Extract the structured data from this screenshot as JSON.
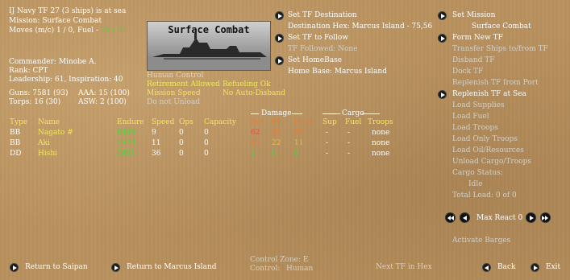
{
  "header": {
    "line1": "IJ Navy TF 27 (3 ships) is at sea",
    "mission": "Mission:  Surface Combat",
    "moves": "Moves (m/c)  1 / 0, Fuel - ",
    "fuel": "76 / 21"
  },
  "commander": {
    "name": "Commander: Minobe A.",
    "rank": "Rank: CPT",
    "leadership": "Leadership: 61, Inspiration: 40"
  },
  "stats": {
    "guns": "Guns: 7581 (93)",
    "aaa": "AAA: 15 (100)",
    "torps": "Torps: 16 (30)",
    "asw": "ASW: 2 (100)"
  },
  "photo_title": "Surface Combat",
  "control": {
    "human": "Human Control",
    "retirement": "Retirement Allowed",
    "mission_speed": "Mission Speed",
    "no_unload": "Do not Unload",
    "refueling": "Refueling Ok",
    "auto_disband": "No Auto-Disband"
  },
  "mid_menu": {
    "set_dest": "Set TF Destination",
    "dest_hex": "Destination Hex: Marcus Island - 75,56",
    "set_follow": "Set TF to Follow",
    "followed": "TF Followed: None",
    "set_home": "Set HomeBase",
    "home": "Home Base: Marcus Island"
  },
  "right_menu": {
    "set_mission": "Set Mission",
    "mission_val": "Surface Combat",
    "form_new": "Form New TF",
    "transfer": "Transfer Ships to/from TF",
    "disband": "Disband TF",
    "dock": "Dock TF",
    "replenish_port": "Replenish TF from Port",
    "replenish_sea": "Replenish TF at Sea",
    "load_supplies": "Load Supplies",
    "load_fuel": "Load Fuel",
    "load_troops": "Load Troops",
    "load_only_troops": "Load Only Troops",
    "load_oil": "Load Oil/Resources",
    "unload": "Unload Cargo/Troops",
    "cargo_status": "Cargo Status:",
    "idle": "Idle",
    "total_load": "Total Load: 0 of 0",
    "max_react": "Max React 0",
    "activate_barges": "Activate Barges"
  },
  "table": {
    "group_damage": "Damage",
    "group_cargo": "Cargo",
    "headers": [
      "Type",
      "Name",
      "Endure",
      "Speed",
      "Ops",
      "Capacity",
      "Sys",
      "Flt",
      "Fires",
      "Sup",
      "Fuel",
      "Troops"
    ],
    "rows": [
      [
        "BB",
        "Nagato #",
        "6499",
        "9",
        "0",
        "0",
        "62",
        "29",
        "27",
        "-",
        "-",
        "none"
      ],
      [
        "BB",
        "Aki",
        "3809",
        "11",
        "0",
        "0",
        "43",
        "22",
        "11",
        "-",
        "-",
        "none"
      ],
      [
        "DD",
        "Hishi",
        "3491",
        "36",
        "0",
        "0",
        "1",
        "0",
        "0",
        "-",
        "-",
        "none"
      ]
    ]
  },
  "footer": {
    "return_saipan": "Return to Saipan",
    "return_marcus": "Return to Marcus Island",
    "control_zone": "Control Zone: E",
    "control": "Control:",
    "control_val": "Human",
    "next_tf": "Next TF in Hex",
    "back": "Back",
    "exit": "Exit"
  },
  "colors": {
    "background": "#b9925f",
    "highlight": "#f2e85a",
    "good": "#46d83a",
    "bad": "#f04a3a"
  }
}
